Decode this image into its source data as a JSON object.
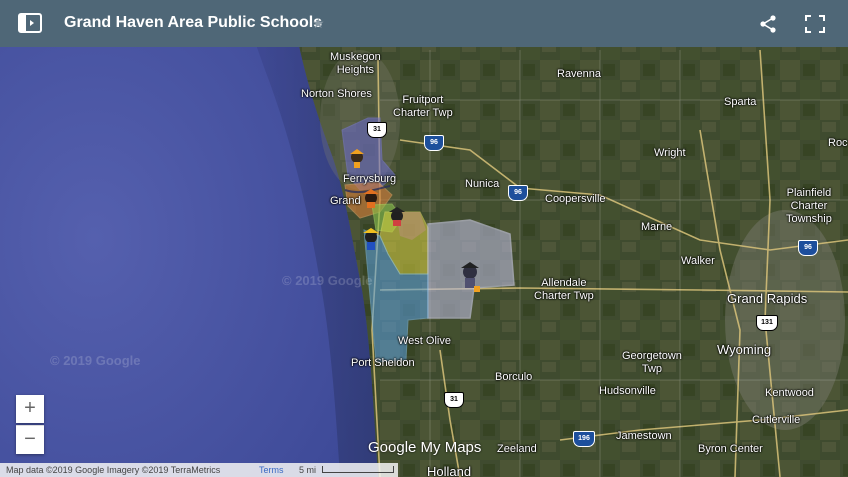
{
  "header": {
    "title": "Grand Haven Area Public Schools",
    "star": "★"
  },
  "places": [
    {
      "id": "muskegon-heights",
      "text": "Muskegon\nHeights"
    },
    {
      "id": "norton-shores",
      "text": "Norton Shores"
    },
    {
      "id": "fruitport",
      "text": "Fruitport\nCharter Twp"
    },
    {
      "id": "ravenna",
      "text": "Ravenna"
    },
    {
      "id": "sparta",
      "text": "Sparta"
    },
    {
      "id": "rockford",
      "text": "Roc"
    },
    {
      "id": "wright",
      "text": "Wright"
    },
    {
      "id": "ferrysburg",
      "text": "Ferrysburg"
    },
    {
      "id": "nunica",
      "text": "Nunica"
    },
    {
      "id": "coopersville",
      "text": "Coopersville"
    },
    {
      "id": "grand-haven",
      "text": "Grand"
    },
    {
      "id": "plainfield",
      "text": "Plainfield\nCharter\nTownship"
    },
    {
      "id": "marne",
      "text": "Marne"
    },
    {
      "id": "walker",
      "text": "Walker"
    },
    {
      "id": "allendale",
      "text": "Allendale\nCharter Twp"
    },
    {
      "id": "grand-rapids",
      "text": "Grand Rapids"
    },
    {
      "id": "west-olive",
      "text": "West Olive"
    },
    {
      "id": "port-sheldon",
      "text": "Port Sheldon"
    },
    {
      "id": "georgetown",
      "text": "Georgetown\nTwp"
    },
    {
      "id": "wyoming",
      "text": "Wyoming"
    },
    {
      "id": "borculo",
      "text": "Borculo"
    },
    {
      "id": "hudsonville",
      "text": "Hudsonville"
    },
    {
      "id": "kentwood",
      "text": "Kentwood"
    },
    {
      "id": "cutlerville",
      "text": "Cutlerville"
    },
    {
      "id": "zeeland",
      "text": "Zeeland"
    },
    {
      "id": "jamestown",
      "text": "Jamestown"
    },
    {
      "id": "byron-center",
      "text": "Byron Center"
    },
    {
      "id": "holland",
      "text": "Holland"
    }
  ],
  "shields": {
    "us31_top": "31",
    "i96_a": "96",
    "i96_b": "96",
    "i96_c": "96",
    "us131": "131",
    "us31_bottom": "31",
    "i196": "196"
  },
  "watermarks": [
    "© 2019 Google",
    "© 2019 Google"
  ],
  "zoom": {
    "in": "+",
    "out": "−"
  },
  "branding": "Google My Maps",
  "attribution": {
    "text": "Map data ©2019 Google Imagery ©2019 TerraMetrics",
    "terms": "Terms",
    "scale": "5 mi"
  },
  "icons": {
    "sidebar": "sidebar-toggle-icon",
    "share": "share-icon",
    "fullscreen": "fullscreen-icon",
    "school": "mascot-icon"
  },
  "colors": {
    "header": "#4f6777",
    "lake": "#4b57a8",
    "land": "#3d4a2e",
    "zone_purple": "#6a6ad0",
    "zone_orange": "#d8803a",
    "zone_green": "#86c04a",
    "zone_yellow": "#d8d040",
    "zone_gray": "#b8b8d8",
    "zone_blue": "#5aa0e0"
  }
}
